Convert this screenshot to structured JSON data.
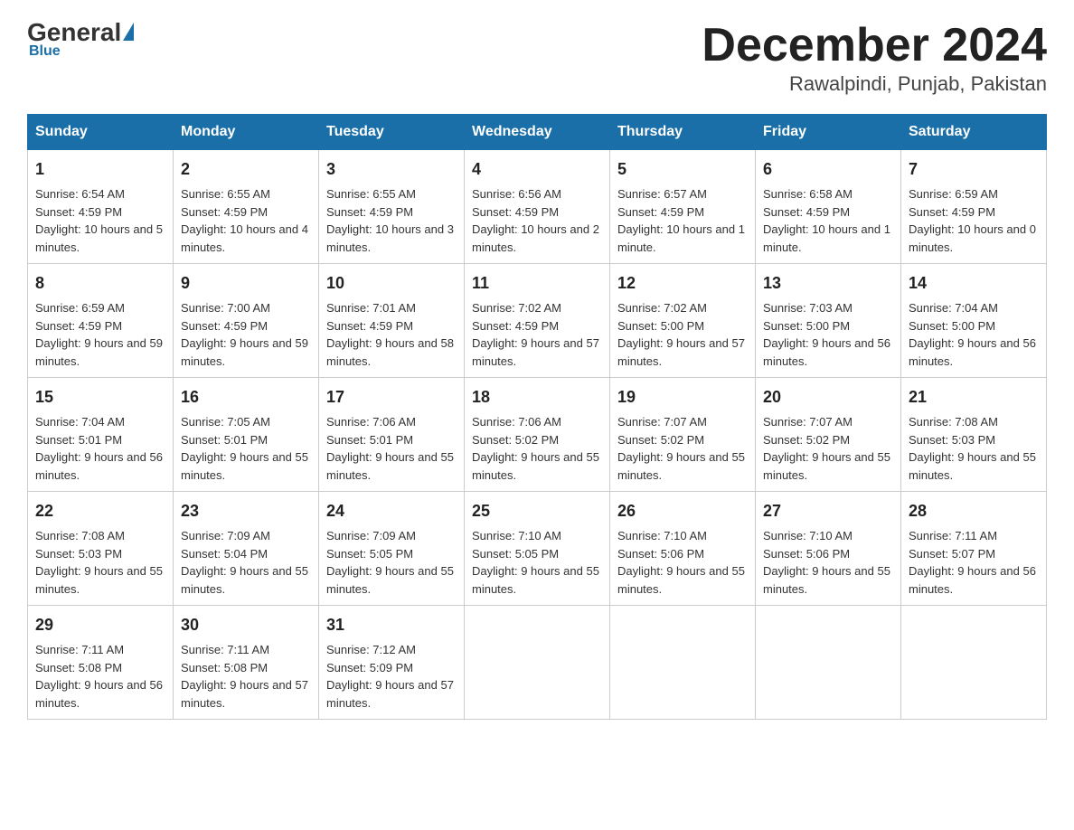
{
  "logo": {
    "general": "General",
    "blue": "Blue",
    "subtitle": "Blue"
  },
  "title": "December 2024",
  "location": "Rawalpindi, Punjab, Pakistan",
  "days_of_week": [
    "Sunday",
    "Monday",
    "Tuesday",
    "Wednesday",
    "Thursday",
    "Friday",
    "Saturday"
  ],
  "weeks": [
    [
      {
        "day": "1",
        "sunrise": "6:54 AM",
        "sunset": "4:59 PM",
        "daylight": "10 hours and 5 minutes."
      },
      {
        "day": "2",
        "sunrise": "6:55 AM",
        "sunset": "4:59 PM",
        "daylight": "10 hours and 4 minutes."
      },
      {
        "day": "3",
        "sunrise": "6:55 AM",
        "sunset": "4:59 PM",
        "daylight": "10 hours and 3 minutes."
      },
      {
        "day": "4",
        "sunrise": "6:56 AM",
        "sunset": "4:59 PM",
        "daylight": "10 hours and 2 minutes."
      },
      {
        "day": "5",
        "sunrise": "6:57 AM",
        "sunset": "4:59 PM",
        "daylight": "10 hours and 1 minute."
      },
      {
        "day": "6",
        "sunrise": "6:58 AM",
        "sunset": "4:59 PM",
        "daylight": "10 hours and 1 minute."
      },
      {
        "day": "7",
        "sunrise": "6:59 AM",
        "sunset": "4:59 PM",
        "daylight": "10 hours and 0 minutes."
      }
    ],
    [
      {
        "day": "8",
        "sunrise": "6:59 AM",
        "sunset": "4:59 PM",
        "daylight": "9 hours and 59 minutes."
      },
      {
        "day": "9",
        "sunrise": "7:00 AM",
        "sunset": "4:59 PM",
        "daylight": "9 hours and 59 minutes."
      },
      {
        "day": "10",
        "sunrise": "7:01 AM",
        "sunset": "4:59 PM",
        "daylight": "9 hours and 58 minutes."
      },
      {
        "day": "11",
        "sunrise": "7:02 AM",
        "sunset": "4:59 PM",
        "daylight": "9 hours and 57 minutes."
      },
      {
        "day": "12",
        "sunrise": "7:02 AM",
        "sunset": "5:00 PM",
        "daylight": "9 hours and 57 minutes."
      },
      {
        "day": "13",
        "sunrise": "7:03 AM",
        "sunset": "5:00 PM",
        "daylight": "9 hours and 56 minutes."
      },
      {
        "day": "14",
        "sunrise": "7:04 AM",
        "sunset": "5:00 PM",
        "daylight": "9 hours and 56 minutes."
      }
    ],
    [
      {
        "day": "15",
        "sunrise": "7:04 AM",
        "sunset": "5:01 PM",
        "daylight": "9 hours and 56 minutes."
      },
      {
        "day": "16",
        "sunrise": "7:05 AM",
        "sunset": "5:01 PM",
        "daylight": "9 hours and 55 minutes."
      },
      {
        "day": "17",
        "sunrise": "7:06 AM",
        "sunset": "5:01 PM",
        "daylight": "9 hours and 55 minutes."
      },
      {
        "day": "18",
        "sunrise": "7:06 AM",
        "sunset": "5:02 PM",
        "daylight": "9 hours and 55 minutes."
      },
      {
        "day": "19",
        "sunrise": "7:07 AM",
        "sunset": "5:02 PM",
        "daylight": "9 hours and 55 minutes."
      },
      {
        "day": "20",
        "sunrise": "7:07 AM",
        "sunset": "5:02 PM",
        "daylight": "9 hours and 55 minutes."
      },
      {
        "day": "21",
        "sunrise": "7:08 AM",
        "sunset": "5:03 PM",
        "daylight": "9 hours and 55 minutes."
      }
    ],
    [
      {
        "day": "22",
        "sunrise": "7:08 AM",
        "sunset": "5:03 PM",
        "daylight": "9 hours and 55 minutes."
      },
      {
        "day": "23",
        "sunrise": "7:09 AM",
        "sunset": "5:04 PM",
        "daylight": "9 hours and 55 minutes."
      },
      {
        "day": "24",
        "sunrise": "7:09 AM",
        "sunset": "5:05 PM",
        "daylight": "9 hours and 55 minutes."
      },
      {
        "day": "25",
        "sunrise": "7:10 AM",
        "sunset": "5:05 PM",
        "daylight": "9 hours and 55 minutes."
      },
      {
        "day": "26",
        "sunrise": "7:10 AM",
        "sunset": "5:06 PM",
        "daylight": "9 hours and 55 minutes."
      },
      {
        "day": "27",
        "sunrise": "7:10 AM",
        "sunset": "5:06 PM",
        "daylight": "9 hours and 55 minutes."
      },
      {
        "day": "28",
        "sunrise": "7:11 AM",
        "sunset": "5:07 PM",
        "daylight": "9 hours and 56 minutes."
      }
    ],
    [
      {
        "day": "29",
        "sunrise": "7:11 AM",
        "sunset": "5:08 PM",
        "daylight": "9 hours and 56 minutes."
      },
      {
        "day": "30",
        "sunrise": "7:11 AM",
        "sunset": "5:08 PM",
        "daylight": "9 hours and 57 minutes."
      },
      {
        "day": "31",
        "sunrise": "7:12 AM",
        "sunset": "5:09 PM",
        "daylight": "9 hours and 57 minutes."
      },
      null,
      null,
      null,
      null
    ]
  ]
}
